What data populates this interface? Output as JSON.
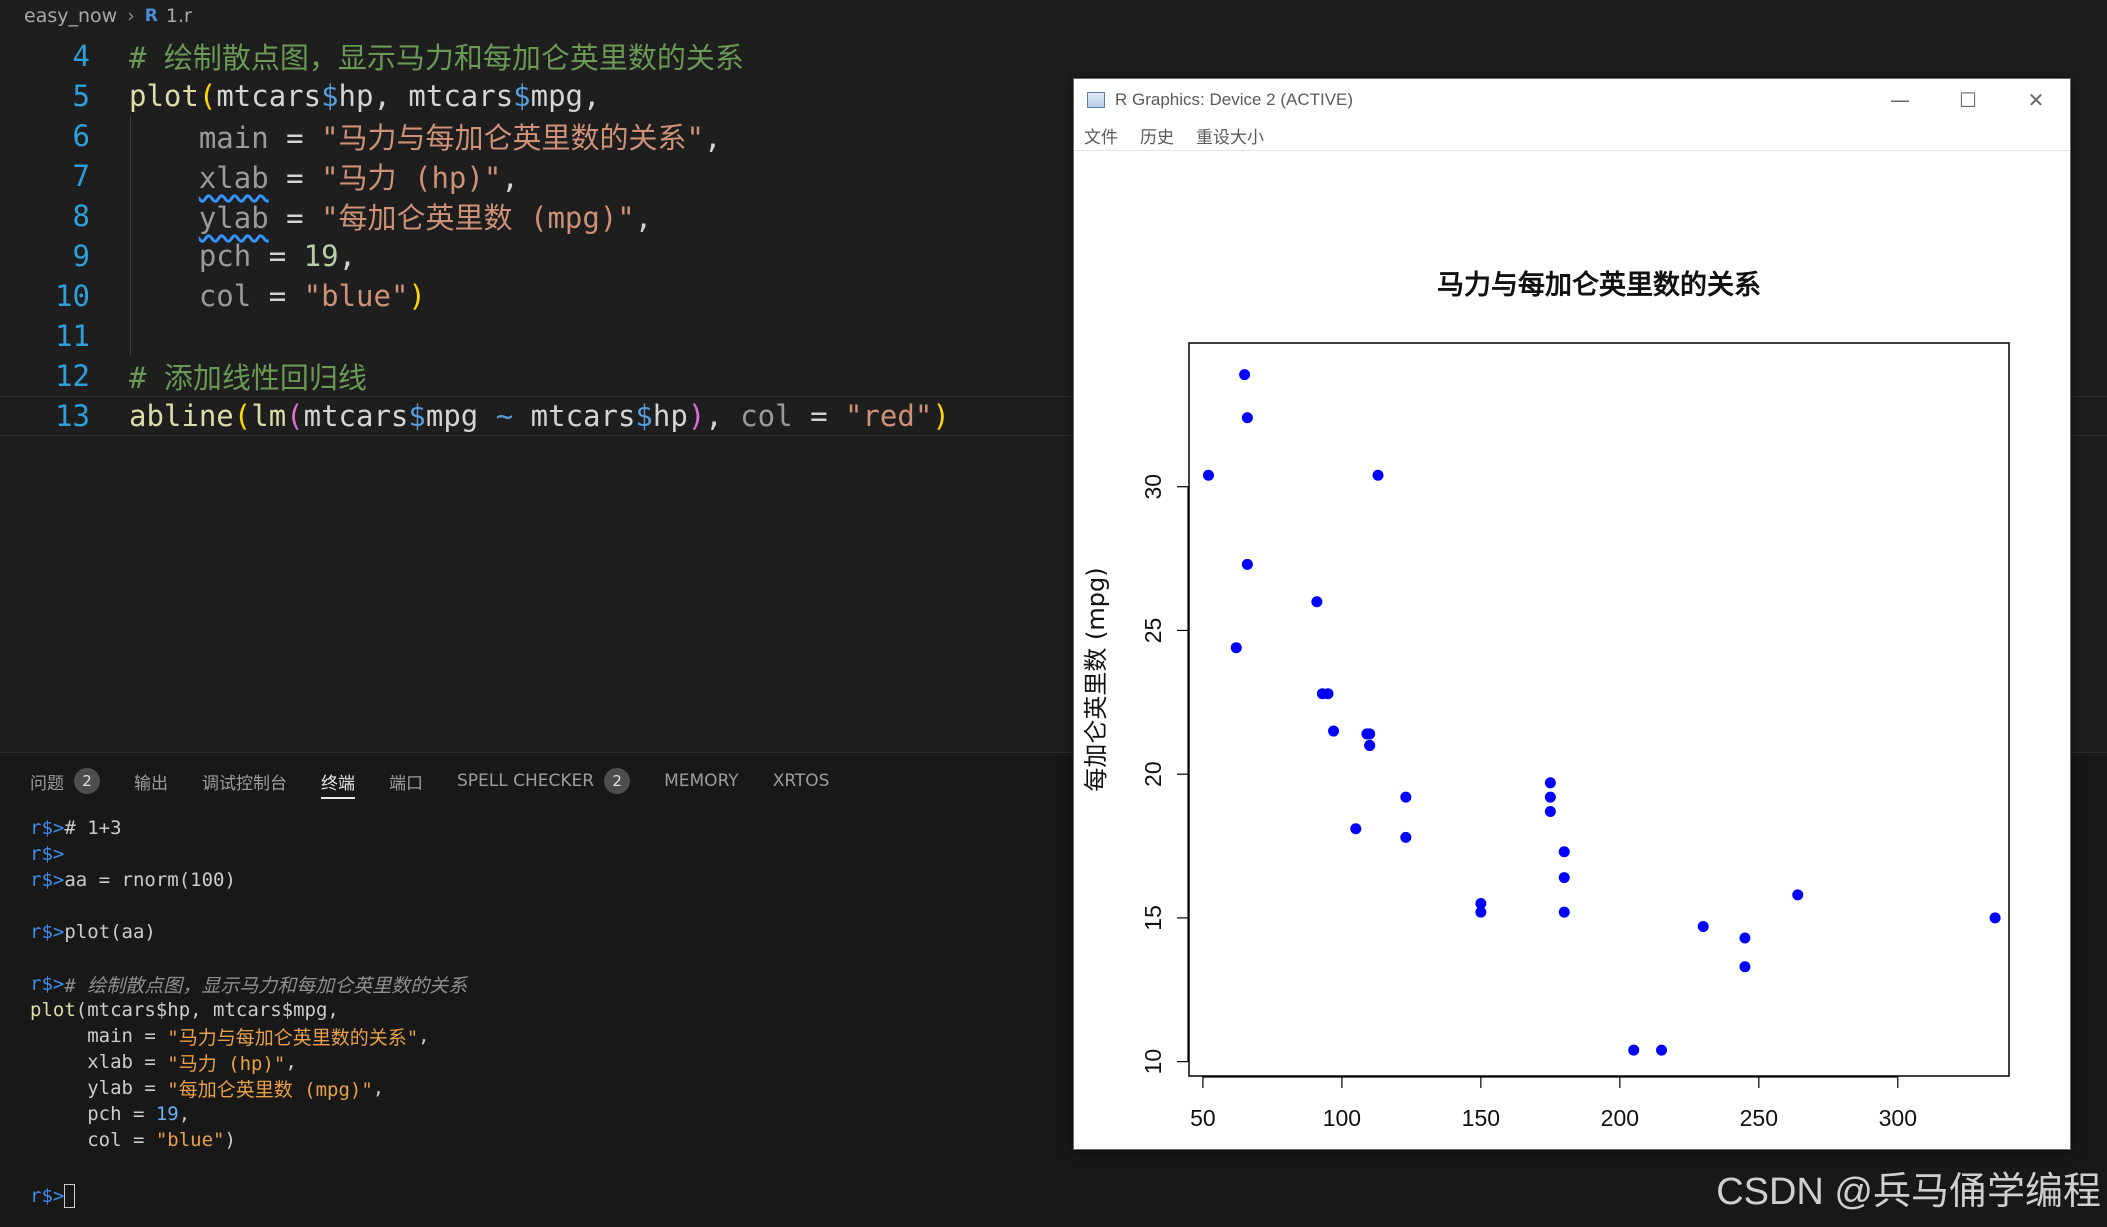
{
  "breadcrumb": {
    "folder": "easy_now",
    "file": "1.r",
    "file_icon": "R"
  },
  "editor": {
    "lines": [
      {
        "num": "4"
      },
      {
        "num": "5"
      },
      {
        "num": "6"
      },
      {
        "num": "7"
      },
      {
        "num": "8"
      },
      {
        "num": "9"
      },
      {
        "num": "10"
      },
      {
        "num": "11"
      },
      {
        "num": "12"
      },
      {
        "num": "13"
      }
    ],
    "code": {
      "l4_comment": "# 绘制散点图，显示马力和每加仑英里数的关系",
      "plot": "plot",
      "mtcars": "mtcars",
      "dollar": "$",
      "hp": "hp",
      "mpg": "mpg",
      "comma": ",",
      "main_arg": "main",
      "main_val": "\"马力与每加仑英里数的关系\"",
      "xlab_arg": "xlab",
      "xlab_val": "\"马力 (hp)\"",
      "ylab_arg": "ylab",
      "ylab_val": "\"每加仑英里数 (mpg)\"",
      "pch_arg": "pch",
      "pch_val": "19",
      "col_arg": "col",
      "col_val": "\"blue\"",
      "l12_comment": "# 添加线性回归线",
      "abline": "abline",
      "lm": "lm",
      "red_val": "\"red\"",
      "eq": "=",
      "tilde": "~"
    }
  },
  "panel": {
    "tabs": [
      {
        "label": "问题",
        "badge": "2"
      },
      {
        "label": "输出"
      },
      {
        "label": "调试控制台"
      },
      {
        "label": "终端",
        "active": true
      },
      {
        "label": "端口"
      },
      {
        "label": "SPELL CHECKER",
        "badge": "2"
      },
      {
        "label": "MEMORY"
      },
      {
        "label": "XRTOS"
      }
    ],
    "terminal": {
      "prompt": "r$>",
      "l1": "# 1+3",
      "l3": "aa = rnorm(100)",
      "l5": "plot(aa)",
      "l7": "# 绘制散点图，显示马力和每加仑英里数的关系",
      "plot": "plot",
      "plot_args": "(mtcars$hp, mtcars$mpg,",
      "main_pre": "     main = ",
      "main_val": "\"马力与每加仑英里数的关系\"",
      "xlab_pre": "     xlab = ",
      "xlab_val": "\"马力 (hp)\"",
      "ylab_pre": "     ylab = ",
      "ylab_val": "\"每加仑英里数 (mpg)\"",
      "pch_pre": "     pch = ",
      "pch_val": "19",
      "col_pre": "     col = ",
      "col_val": "\"blue\"",
      "comma": ",",
      "close": ")"
    }
  },
  "rgraphics": {
    "title": "R Graphics: Device 2 (ACTIVE)",
    "menu": [
      "文件",
      "历史",
      "重设大小"
    ],
    "controls": {
      "minimize": "—",
      "maximize": "☐",
      "close": "✕"
    }
  },
  "chart_data": {
    "type": "scatter",
    "title": "马力与每加仑英里数的关系",
    "xlabel": "马力 (hp)",
    "ylabel": "每加仑英里数 (mpg)",
    "xlim": [
      45,
      340
    ],
    "ylim": [
      9.5,
      35
    ],
    "xticks": [
      50,
      100,
      150,
      200,
      250,
      300
    ],
    "yticks": [
      10,
      15,
      20,
      25,
      30
    ],
    "point_color": "#0000ff",
    "grid": false,
    "points": [
      [
        110,
        21.0
      ],
      [
        110,
        21.0
      ],
      [
        93,
        22.8
      ],
      [
        110,
        21.4
      ],
      [
        175,
        18.7
      ],
      [
        105,
        18.1
      ],
      [
        245,
        14.3
      ],
      [
        62,
        24.4
      ],
      [
        95,
        22.8
      ],
      [
        123,
        19.2
      ],
      [
        123,
        17.8
      ],
      [
        180,
        16.4
      ],
      [
        180,
        17.3
      ],
      [
        180,
        15.2
      ],
      [
        205,
        10.4
      ],
      [
        215,
        10.4
      ],
      [
        230,
        14.7
      ],
      [
        66,
        32.4
      ],
      [
        52,
        30.4
      ],
      [
        65,
        33.9
      ],
      [
        97,
        21.5
      ],
      [
        150,
        15.5
      ],
      [
        150,
        15.2
      ],
      [
        245,
        13.3
      ],
      [
        175,
        19.2
      ],
      [
        66,
        27.3
      ],
      [
        91,
        26.0
      ],
      [
        113,
        30.4
      ],
      [
        264,
        15.8
      ],
      [
        175,
        19.7
      ],
      [
        335,
        15.0
      ],
      [
        109,
        21.4
      ]
    ]
  },
  "watermark": "CSDN @兵马俑学编程"
}
